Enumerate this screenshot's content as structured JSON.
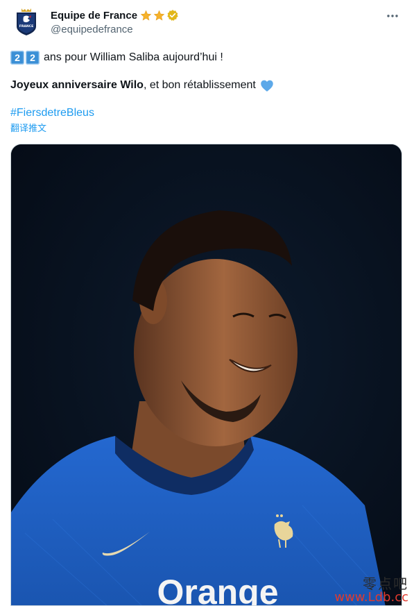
{
  "author": {
    "display_name": "Equipe de France",
    "handle": "@equipedefrance",
    "avatar_icon": "fff-crest-icon",
    "name_badges": [
      "star-icon",
      "star-icon",
      "verified-gold-icon"
    ],
    "verified_color": "#e2b719"
  },
  "tweet": {
    "keycaps": [
      "2",
      "2"
    ],
    "line1_text": "ans pour William Saliba aujourd’hui !",
    "line2_bold": "Joyeux anniversaire Wilo",
    "line2_rest": ", et bon rétablissement",
    "line2_emoji": "blue-heart-icon",
    "hashtag": "#FiersdetreBleus",
    "translate_label": "翻译推文"
  },
  "photo": {
    "jersey_text": "Orange",
    "crest_label": "FRANCE",
    "description_icons": [
      "rooster-crest-icon",
      "swoosh-icon"
    ]
  },
  "more_icon": "more-horizontal-icon",
  "watermark": {
    "chinese": "零点吧",
    "url": "www.Ldb.cc"
  },
  "colors": {
    "link": "#1d9bf0",
    "text": "#0f1419",
    "secondary": "#536471",
    "jersey_blue": "#1c5fc4"
  }
}
